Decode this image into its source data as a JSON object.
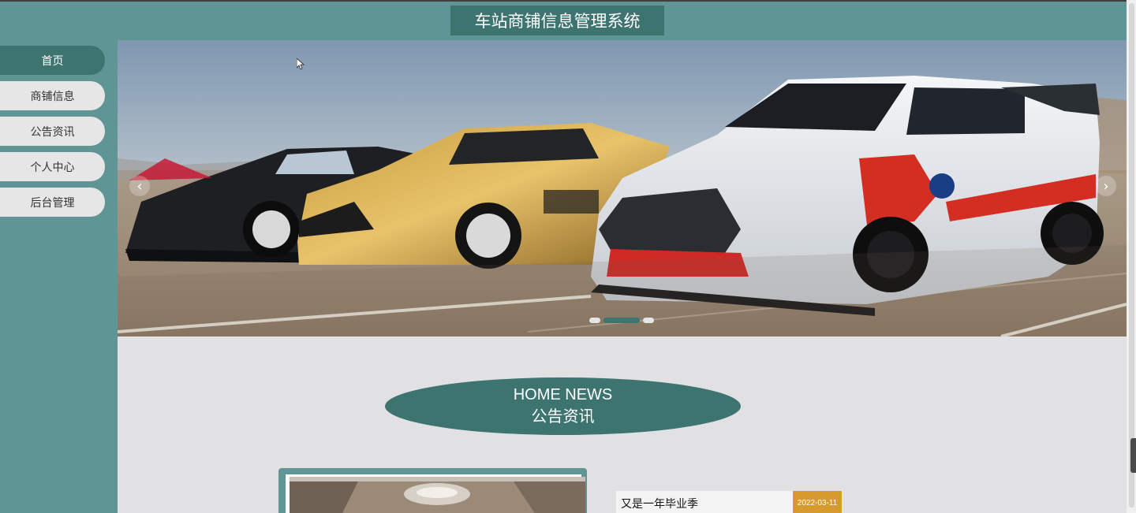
{
  "header": {
    "title": "车站商铺信息管理系统"
  },
  "sidebar": {
    "items": [
      {
        "label": "首页",
        "active": true
      },
      {
        "label": "商铺信息",
        "active": false
      },
      {
        "label": "公告资讯",
        "active": false
      },
      {
        "label": "个人中心",
        "active": false
      },
      {
        "label": "后台管理",
        "active": false
      }
    ]
  },
  "banner": {
    "prev_icon": "chevron-left-icon",
    "next_icon": "chevron-right-icon",
    "slide_count": 3,
    "active_slide": 2
  },
  "news": {
    "heading_en": "HOME NEWS",
    "heading_cn": "公告资讯",
    "items": [
      {
        "title": "又是一年毕业季",
        "date": "2022-03-11"
      }
    ]
  },
  "colors": {
    "accent": "#3d7470",
    "sidebar_bg": "#5f9595",
    "date_badge": "#d69a2d",
    "main_bg": "#e1e1e3"
  }
}
